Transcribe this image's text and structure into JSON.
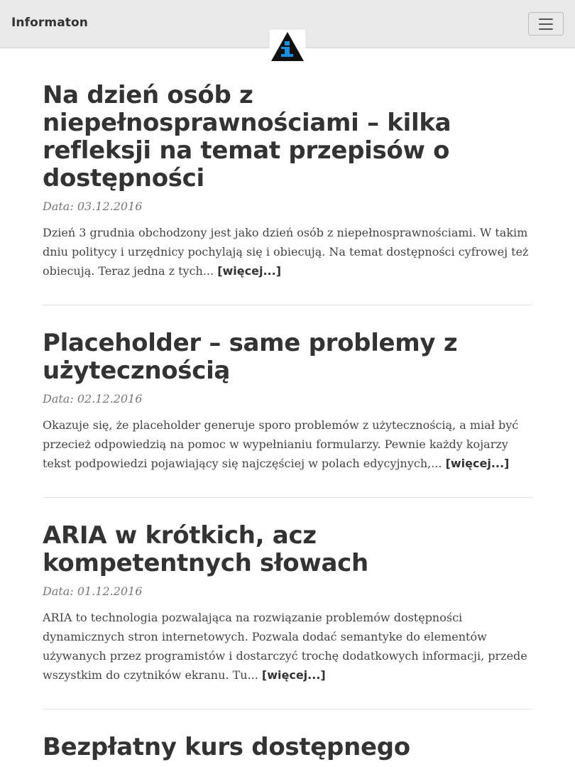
{
  "navbar": {
    "brand": "Informaton",
    "logo_name": "information-logo-icon",
    "menu_icon": "hamburger-menu-icon"
  },
  "colors": {
    "navbar_bg": "#e9e9e9",
    "logo_blue": "#1b8fe0",
    "text": "#333333",
    "date": "#777777"
  },
  "posts": [
    {
      "title": "Na dzień osób z niepełnosprawnościami – kilka refleksji na temat przepisów o dostępności",
      "date": "Data: 03.12.2016",
      "excerpt": "Dzień 3 grudnia obchodzony jest jako dzień osób z niepełnosprawnościami. W takim dniu politycy i urzędnicy pochylają się i obiecują. Na temat dostępności cyfrowej też obiecują. Teraz jedna z tych...",
      "more": "[więcej...]"
    },
    {
      "title": "Placeholder – same problemy z użytecznością",
      "date": "Data: 02.12.2016",
      "excerpt": "Okazuje się, że placeholder generuje sporo problemów z użytecznością, a miał być przecież odpowiedzią na pomoc w wypełnianiu formularzy. Pewnie każdy kojarzy tekst podpowiedzi pojawiający się najczęściej w polach edycyjnych,...",
      "more": "[więcej...]"
    },
    {
      "title": "ARIA w krótkich, acz kompetentnych słowach",
      "date": "Data: 01.12.2016",
      "excerpt": "ARIA to technologia pozwalająca na rozwiązanie problemów dostępności dynamicznych stron internetowych. Pozwala dodać semantyke do elementów używanych przez programistów i dostarczyć trochę dodatkowych informacji, przede wszystkim do czytników ekranu. Tu...",
      "more": "[więcej...]"
    },
    {
      "title": "Bezpłatny kurs dostępnego"
    }
  ]
}
